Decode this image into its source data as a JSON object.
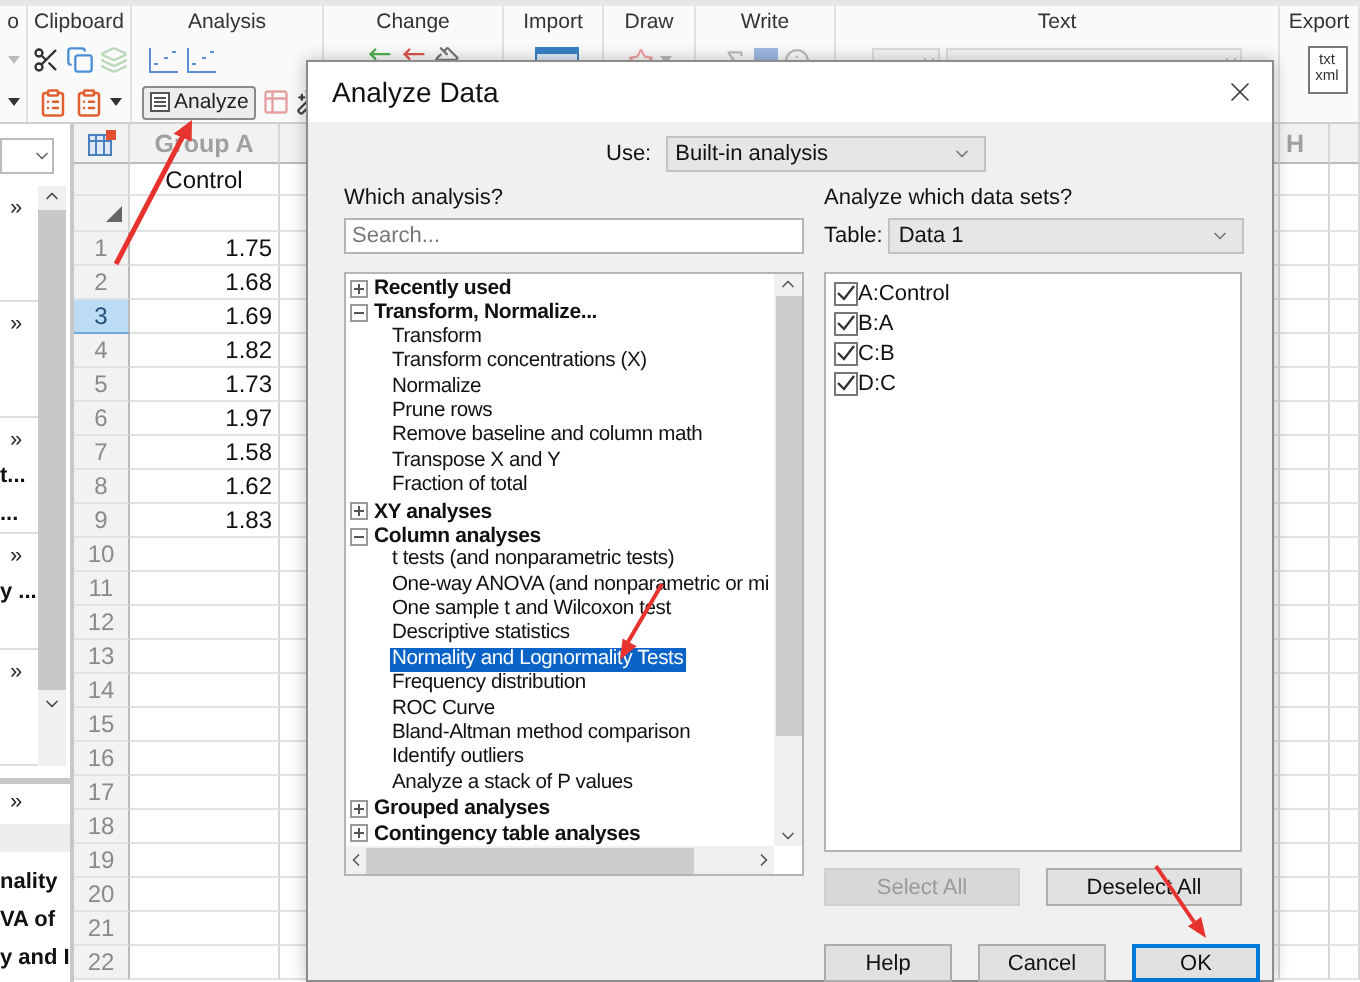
{
  "ribbon": {
    "groups": [
      {
        "kind": "partial",
        "label": "o"
      },
      {
        "kind": "clipboard",
        "label": "Clipboard"
      },
      {
        "kind": "analysis",
        "label": "Analysis",
        "button": "Analyze"
      },
      {
        "kind": "change",
        "label": "Change"
      },
      {
        "kind": "import",
        "label": "Import"
      },
      {
        "kind": "draw",
        "label": "Draw"
      },
      {
        "kind": "write",
        "label": "Write"
      },
      {
        "kind": "text",
        "label": "Text"
      },
      {
        "kind": "export",
        "label": "Export",
        "icon_text": [
          "txt",
          "xml"
        ]
      }
    ]
  },
  "navigator": {
    "sections": [
      {
        "items": [
          {
            "kind": "expander",
            "text": "»"
          }
        ]
      },
      {
        "items": [
          {
            "kind": "expander",
            "text": "»"
          }
        ]
      },
      {
        "items": [
          {
            "kind": "expander",
            "text": "»"
          },
          {
            "kind": "entry",
            "text": "t..."
          },
          {
            "kind": "entry",
            "text": "..."
          }
        ]
      },
      {
        "items": [
          {
            "kind": "expander",
            "text": "»"
          },
          {
            "kind": "entry",
            "text": "y ..."
          }
        ]
      },
      {
        "items": [
          {
            "kind": "expander",
            "text": "»"
          }
        ]
      }
    ],
    "lower": [
      {
        "kind": "expander",
        "text": "»"
      },
      {
        "kind": "entry",
        "text": "nality"
      },
      {
        "kind": "entry",
        "text": "VA of"
      },
      {
        "kind": "entry",
        "text": "y and I"
      }
    ]
  },
  "sheet": {
    "columns": [
      {
        "header": "Group A",
        "title": "Control"
      },
      {
        "header": "H"
      }
    ],
    "rows": [
      {
        "number": "1",
        "value": "1.75",
        "selected": false
      },
      {
        "number": "2",
        "value": "1.68",
        "selected": false
      },
      {
        "number": "3",
        "value": "1.69",
        "selected": true
      },
      {
        "number": "4",
        "value": "1.82",
        "selected": false
      },
      {
        "number": "5",
        "value": "1.73",
        "selected": false
      },
      {
        "number": "6",
        "value": "1.97",
        "selected": false
      },
      {
        "number": "7",
        "value": "1.58",
        "selected": false
      },
      {
        "number": "8",
        "value": "1.62",
        "selected": false
      },
      {
        "number": "9",
        "value": "1.83",
        "selected": false
      },
      {
        "number": "10",
        "selected": false
      },
      {
        "number": "11",
        "selected": false
      },
      {
        "number": "12",
        "selected": false
      },
      {
        "number": "13",
        "selected": false
      },
      {
        "number": "14",
        "selected": false
      },
      {
        "number": "15",
        "selected": false
      },
      {
        "number": "16",
        "selected": false
      },
      {
        "number": "17",
        "selected": false
      },
      {
        "number": "18",
        "selected": false
      },
      {
        "number": "19",
        "selected": false
      },
      {
        "number": "20",
        "selected": false
      },
      {
        "number": "21",
        "selected": false
      },
      {
        "number": "22",
        "selected": false
      }
    ]
  },
  "dialog": {
    "title": "Analyze Data",
    "use_label": "Use:",
    "use_value": "Built-in analysis",
    "analysis_label": "Which analysis?",
    "search": {
      "placeholder": "Search..."
    },
    "tree": [
      {
        "label": "Recently used",
        "expanded": false
      },
      {
        "label": "Transform, Normalize...",
        "expanded": true,
        "children": [
          {
            "label": "Transform",
            "selected": false
          },
          {
            "label": "Transform concentrations (X)",
            "selected": false
          },
          {
            "label": "Normalize",
            "selected": false
          },
          {
            "label": "Prune rows",
            "selected": false
          },
          {
            "label": "Remove baseline and column math",
            "selected": false
          },
          {
            "label": "Transpose X and Y",
            "selected": false
          },
          {
            "label": "Fraction of total",
            "selected": false
          }
        ]
      },
      {
        "label": "XY analyses",
        "expanded": false
      },
      {
        "label": "Column analyses",
        "expanded": true,
        "children": [
          {
            "label": "t tests (and nonparametric tests)",
            "selected": false
          },
          {
            "label": "One-way ANOVA (and nonparametric or mi",
            "selected": false
          },
          {
            "label": "One sample t and Wilcoxon test",
            "selected": false
          },
          {
            "label": "Descriptive statistics",
            "selected": false
          },
          {
            "label": "Normality and Lognormality Tests",
            "selected": true
          },
          {
            "label": "Frequency distribution",
            "selected": false
          },
          {
            "label": "ROC Curve",
            "selected": false
          },
          {
            "label": "Bland-Altman method comparison",
            "selected": false
          },
          {
            "label": "Identify outliers",
            "selected": false
          },
          {
            "label": "Analyze a stack of P values",
            "selected": false
          }
        ]
      },
      {
        "label": "Grouped analyses",
        "expanded": false
      },
      {
        "label": "Contingency table analyses",
        "expanded": false
      }
    ],
    "datasets_label": "Analyze which data sets?",
    "table_label": "Table:",
    "table_value": "Data 1",
    "datasets": [
      {
        "label": "A:Control",
        "checked": true
      },
      {
        "label": "B:A",
        "checked": true
      },
      {
        "label": "C:B",
        "checked": true
      },
      {
        "label": "D:C",
        "checked": true
      }
    ],
    "buttons": [
      {
        "label": "Select All",
        "disabled": true
      },
      {
        "label": "Deselect All",
        "disabled": false
      }
    ],
    "footer_buttons": [
      {
        "label": "Help",
        "default": false
      },
      {
        "label": "Cancel",
        "default": false
      },
      {
        "label": "OK",
        "default": true
      }
    ]
  }
}
